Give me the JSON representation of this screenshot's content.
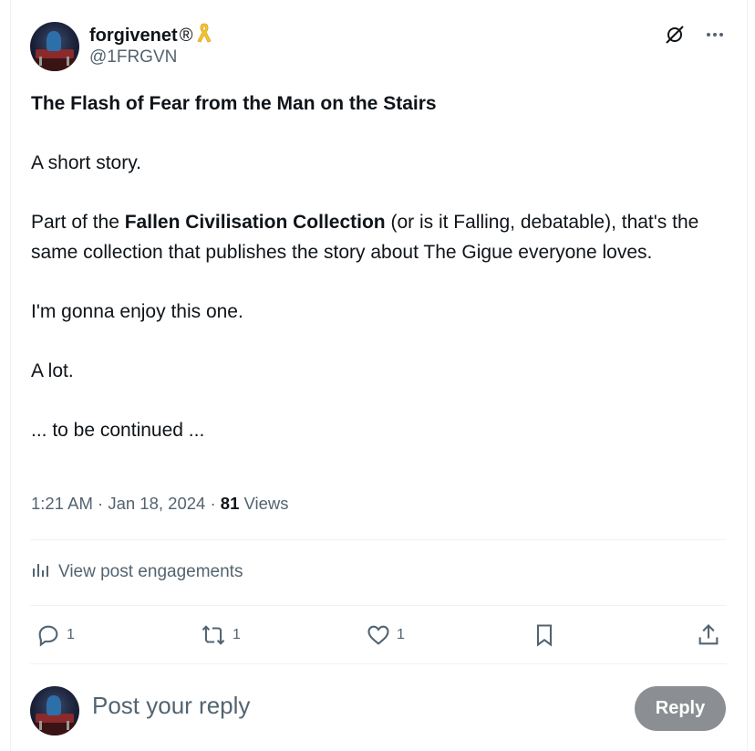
{
  "author": {
    "display_name": "forgivenet",
    "registered_mark": "®",
    "handle": "@1FRGVN"
  },
  "post": {
    "title": "The Flash of Fear from the Man on the Stairs",
    "line1": "A short story.",
    "part_prefix": "Part of the ",
    "part_bold": "Fallen Civilisation Collection",
    "part_suffix": " (or is it Falling, debatable), that's the same collection that publishes the story about The Gigue everyone loves.",
    "line3": "I'm gonna enjoy this one.",
    "line4": "A lot.",
    "line5": "... to be continued ..."
  },
  "meta": {
    "time": "1:21 AM",
    "sep1": " · ",
    "date": "Jan 18, 2024",
    "sep2": " · ",
    "views_count": "81",
    "views_label": " Views"
  },
  "engagements_label": "View post engagements",
  "actions": {
    "reply_count": "1",
    "repost_count": "1",
    "like_count": "1"
  },
  "composer": {
    "placeholder": "Post your reply",
    "reply_button": "Reply"
  },
  "colors": {
    "text": "#0f1419",
    "muted": "#536471",
    "reply_button_bg": "#8b8f93",
    "ribbon": "#f4c430"
  }
}
